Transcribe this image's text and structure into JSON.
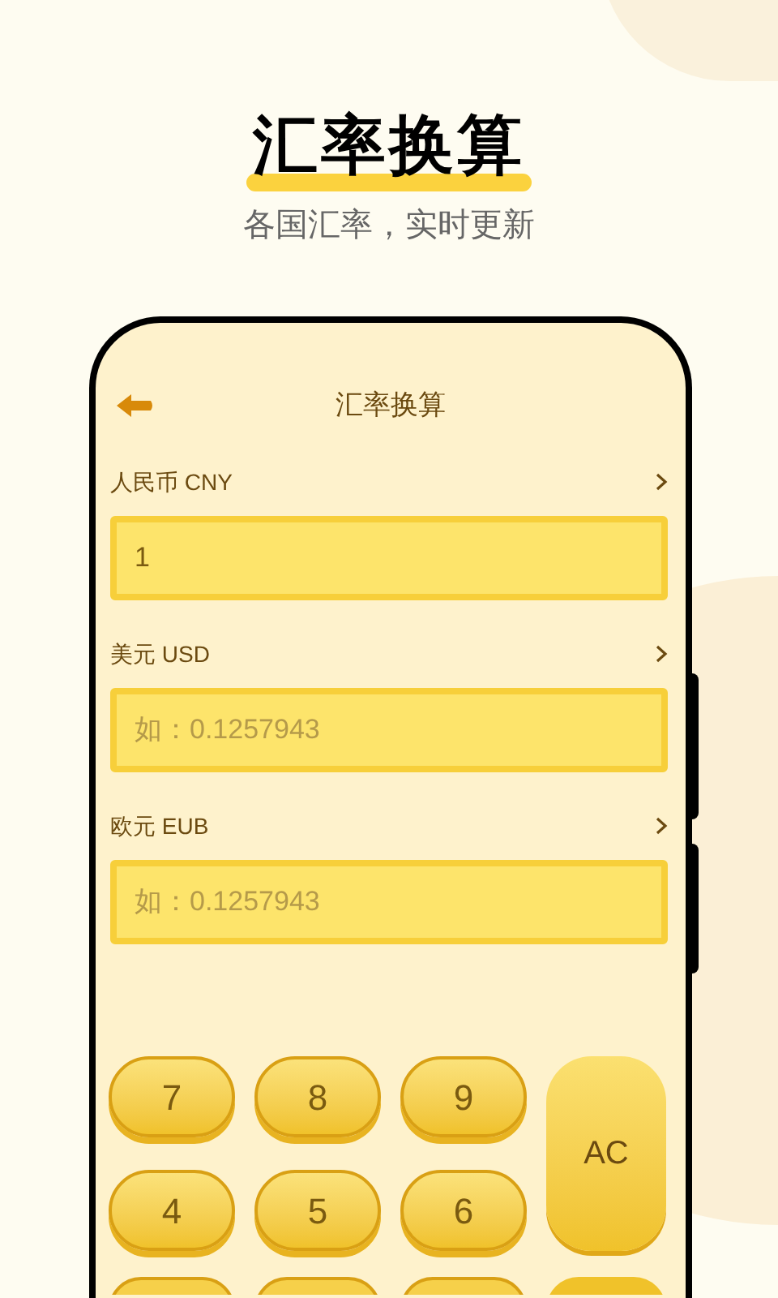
{
  "headline": "汇率换算",
  "subtitle": "各国汇率，实时更新",
  "app": {
    "title": "汇率换算",
    "currencies": [
      {
        "label": "人民币 CNY",
        "value": "1"
      },
      {
        "label": "美元 USD",
        "placeholder": "如：0.1257943"
      },
      {
        "label": "欧元 EUB",
        "placeholder": "如：0.1257943"
      }
    ],
    "keypad": [
      {
        "label": "7",
        "kind": "digit"
      },
      {
        "label": "8",
        "kind": "digit"
      },
      {
        "label": "9",
        "kind": "digit"
      },
      {
        "label": "AC",
        "kind": "clear"
      },
      {
        "label": "4",
        "kind": "digit"
      },
      {
        "label": "5",
        "kind": "digit"
      },
      {
        "label": "6",
        "kind": "digit"
      }
    ]
  }
}
